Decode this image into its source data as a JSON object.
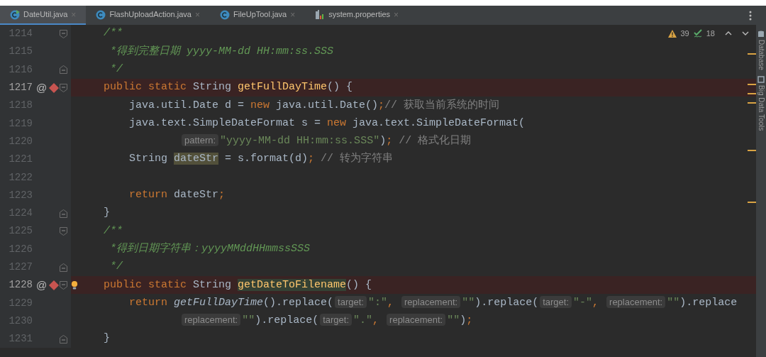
{
  "tabs": [
    {
      "label": "DateUtil.java",
      "kind": "class-run",
      "close": "×",
      "selected": true
    },
    {
      "label": "FlashUploadAction.java",
      "kind": "class",
      "close": "×",
      "selected": false
    },
    {
      "label": "FileUpTool.java",
      "kind": "class",
      "close": "×",
      "selected": false
    },
    {
      "label": "system.properties",
      "kind": "properties",
      "close": "×",
      "selected": false
    }
  ],
  "inspections": {
    "warnings": "39",
    "weak_warnings": "18"
  },
  "side_tools": [
    "Database",
    "Big Data Tools"
  ],
  "lines": [
    {
      "number": "1214",
      "kind": "code",
      "highlighted": false,
      "fold": {
        "kind": "start"
      },
      "tokens": [
        {
          "kind": "doc",
          "text": "    /**"
        }
      ]
    },
    {
      "number": "1215",
      "kind": "code",
      "highlighted": false,
      "tokens": [
        {
          "kind": "doc",
          "text": "     *得到完整日期 yyyy-MM-dd HH:mm:ss.SSS"
        }
      ]
    },
    {
      "number": "1216",
      "kind": "code",
      "highlighted": false,
      "fold": {
        "kind": "end"
      },
      "tokens": [
        {
          "kind": "doc",
          "text": "     */"
        }
      ]
    },
    {
      "number": "1217",
      "kind": "code",
      "highlighted": true,
      "fold": {
        "kind": "start"
      },
      "gutter": [
        {
          "kind": "override",
          "symbol": "@"
        },
        {
          "kind": "breakpoint"
        }
      ],
      "tokens": [
        {
          "kind": "keyword",
          "text": "    public static "
        },
        {
          "kind": "plain",
          "text": "String "
        },
        {
          "kind": "declaration",
          "text": "getFullDayTime"
        },
        {
          "kind": "plain",
          "text": "() {"
        }
      ]
    },
    {
      "number": "1218",
      "kind": "code",
      "highlighted": false,
      "tokens": [
        {
          "kind": "plain",
          "text": "        java.util.Date d = "
        },
        {
          "kind": "keyword",
          "text": "new"
        },
        {
          "kind": "plain",
          "text": " java.util.Date()"
        },
        {
          "kind": "keyword",
          "text": ";"
        },
        {
          "kind": "comment",
          "text": "// 获取当前系统的时间"
        }
      ]
    },
    {
      "number": "1219",
      "kind": "code",
      "highlighted": false,
      "tokens": [
        {
          "kind": "plain",
          "text": "        java.text.SimpleDateFormat s = "
        },
        {
          "kind": "keyword",
          "text": "new"
        },
        {
          "kind": "plain",
          "text": " java.text.SimpleDateFormat("
        }
      ]
    },
    {
      "number": "1220",
      "kind": "continuation",
      "highlighted": false,
      "tokens": [
        {
          "kind": "hint",
          "text": "pattern:"
        },
        {
          "kind": "string",
          "text": "\"yyyy-MM-dd HH:mm:ss.SSS\""
        },
        {
          "kind": "plain",
          "text": ")"
        },
        {
          "kind": "keyword",
          "text": ";"
        },
        {
          "kind": "comment",
          "text": " // 格式化日期"
        }
      ]
    },
    {
      "number": "1221",
      "kind": "code",
      "highlighted": false,
      "tokens": [
        {
          "kind": "plain",
          "text": "        String "
        },
        {
          "kind": "usage",
          "text": "dateStr"
        },
        {
          "kind": "plain",
          "text": " = s.format(d)"
        },
        {
          "kind": "keyword",
          "text": ";"
        },
        {
          "kind": "comment",
          "text": " // 转为字符串"
        }
      ]
    },
    {
      "number": "1222",
      "highlighted": false
    },
    {
      "number": "1223",
      "kind": "code",
      "highlighted": false,
      "tokens": [
        {
          "kind": "keyword",
          "text": "        return "
        },
        {
          "kind": "plain",
          "text": "dateStr"
        },
        {
          "kind": "keyword",
          "text": ";"
        }
      ]
    },
    {
      "number": "1224",
      "kind": "code",
      "highlighted": false,
      "fold": {
        "kind": "end"
      },
      "tokens": [
        {
          "kind": "plain",
          "text": "    }"
        }
      ]
    },
    {
      "number": "1225",
      "kind": "code",
      "highlighted": false,
      "fold": {
        "kind": "start"
      },
      "tokens": [
        {
          "kind": "doc",
          "text": "    /**"
        }
      ]
    },
    {
      "number": "1226",
      "kind": "code",
      "highlighted": false,
      "tokens": [
        {
          "kind": "doc",
          "text": "     *得到日期字符串：yyyyMMddHHmmssSSS"
        }
      ]
    },
    {
      "number": "1227",
      "kind": "code",
      "highlighted": false,
      "fold": {
        "kind": "end"
      },
      "tokens": [
        {
          "kind": "doc",
          "text": "     */"
        }
      ]
    },
    {
      "number": "1228",
      "kind": "code",
      "highlighted": true,
      "fold": {
        "kind": "start"
      },
      "gutter": [
        {
          "kind": "override",
          "symbol": "@"
        },
        {
          "kind": "breakpoint"
        },
        {
          "kind": "bulb"
        }
      ],
      "tokens": [
        {
          "kind": "keyword",
          "text": "    public static "
        },
        {
          "kind": "plain",
          "text": "String "
        },
        {
          "kind": "declaration-usage",
          "text": "getDateToFilename"
        },
        {
          "kind": "plain",
          "text": "() {"
        }
      ]
    },
    {
      "number": "1229",
      "kind": "code",
      "highlighted": false,
      "tokens": [
        {
          "kind": "keyword",
          "text": "        return "
        },
        {
          "kind": "call",
          "text": "getFullDayTime"
        },
        {
          "kind": "plain",
          "text": "().replace("
        },
        {
          "kind": "hint",
          "text": "target:"
        },
        {
          "kind": "string",
          "text": "\":\""
        },
        {
          "kind": "keyword",
          "text": ", "
        },
        {
          "kind": "hint",
          "text": "replacement:"
        },
        {
          "kind": "string",
          "text": "\"\""
        },
        {
          "kind": "plain",
          "text": ").replace("
        },
        {
          "kind": "hint",
          "text": "target:"
        },
        {
          "kind": "string",
          "text": "\"-\""
        },
        {
          "kind": "keyword",
          "text": ", "
        },
        {
          "kind": "hint",
          "text": "replacement:"
        },
        {
          "kind": "string",
          "text": "\"\""
        },
        {
          "kind": "plain",
          "text": ").replace"
        }
      ]
    },
    {
      "number": "1230",
      "kind": "continuation",
      "highlighted": false,
      "tokens": [
        {
          "kind": "hint",
          "text": "replacement:"
        },
        {
          "kind": "string",
          "text": "\"\""
        },
        {
          "kind": "plain",
          "text": ").replace("
        },
        {
          "kind": "hint",
          "text": "target:"
        },
        {
          "kind": "string",
          "text": "\".\""
        },
        {
          "kind": "keyword",
          "text": ", "
        },
        {
          "kind": "hint",
          "text": "replacement:"
        },
        {
          "kind": "string",
          "text": "\"\""
        },
        {
          "kind": "plain",
          "text": ")"
        },
        {
          "kind": "keyword",
          "text": ";"
        }
      ]
    },
    {
      "number": "1231",
      "kind": "code",
      "highlighted": false,
      "fold": {
        "kind": "end"
      },
      "tokens": [
        {
          "kind": "plain",
          "text": "    }"
        }
      ]
    }
  ]
}
